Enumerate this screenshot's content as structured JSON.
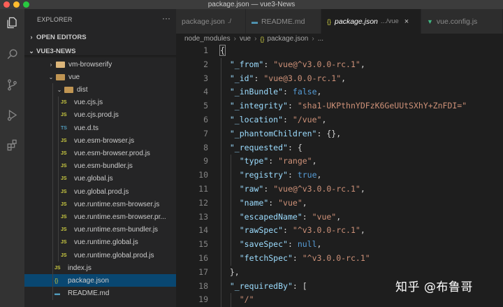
{
  "window": {
    "title": "package.json — vue3-News"
  },
  "activity_bar": {
    "icons": [
      "files-icon",
      "search-icon",
      "source-control-icon",
      "run-debug-icon",
      "extensions-icon"
    ]
  },
  "sidebar": {
    "title": "EXPLORER",
    "open_editors": "OPEN EDITORS",
    "project": "VUE3-NEWS",
    "tree": [
      {
        "label": "vm-browserify",
        "kind": "folder"
      },
      {
        "label": "vue",
        "kind": "folder-open"
      },
      {
        "label": "dist",
        "kind": "folder-open"
      },
      {
        "label": "vue.cjs.js",
        "kind": "js"
      },
      {
        "label": "vue.cjs.prod.js",
        "kind": "js"
      },
      {
        "label": "vue.d.ts",
        "kind": "ts"
      },
      {
        "label": "vue.esm-browser.js",
        "kind": "js"
      },
      {
        "label": "vue.esm-browser.prod.js",
        "kind": "js"
      },
      {
        "label": "vue.esm-bundler.js",
        "kind": "js"
      },
      {
        "label": "vue.global.js",
        "kind": "js"
      },
      {
        "label": "vue.global.prod.js",
        "kind": "js"
      },
      {
        "label": "vue.runtime.esm-browser.js",
        "kind": "js"
      },
      {
        "label": "vue.runtime.esm-browser.pr...",
        "kind": "js"
      },
      {
        "label": "vue.runtime.esm-bundler.js",
        "kind": "js"
      },
      {
        "label": "vue.runtime.global.js",
        "kind": "js"
      },
      {
        "label": "vue.runtime.global.prod.js",
        "kind": "js"
      },
      {
        "label": "index.js",
        "kind": "js"
      },
      {
        "label": "package.json",
        "kind": "json",
        "selected": true
      },
      {
        "label": "README.md",
        "kind": "md"
      }
    ],
    "badges": {
      "js": "JS",
      "ts": "TS",
      "json": "{}",
      "md": "▬"
    }
  },
  "tabs": [
    {
      "label": "package.json",
      "desc": "./",
      "icon": "{}"
    },
    {
      "label": "README.md",
      "desc": "",
      "icon": "▬"
    },
    {
      "label": "package.json",
      "desc": ".../vue",
      "icon": "{}",
      "active": true,
      "close": "×"
    },
    {
      "label": "vue.config.js",
      "desc": "",
      "icon": "▼"
    }
  ],
  "breadcrumb": [
    "node_modules",
    "vue",
    "package.json",
    "..."
  ],
  "editor": {
    "line_numbers": [
      "1",
      "2",
      "3",
      "4",
      "5",
      "6",
      "7",
      "8",
      "9",
      "10",
      "11",
      "12",
      "13",
      "14",
      "15",
      "16",
      "17",
      "18",
      "19"
    ],
    "lines": [
      {
        "indent": 0,
        "pre": "",
        "key": "",
        "mid": "",
        "val": "",
        "post": "{"
      },
      {
        "indent": 1,
        "pre": "",
        "key": "\"_from\"",
        "mid": ": ",
        "val": "\"vue@^v3.0.0-rc.1\"",
        "post": ",",
        "vt": "s"
      },
      {
        "indent": 1,
        "pre": "",
        "key": "\"_id\"",
        "mid": ": ",
        "val": "\"vue@3.0.0-rc.1\"",
        "post": ",",
        "vt": "s"
      },
      {
        "indent": 1,
        "pre": "",
        "key": "\"_inBundle\"",
        "mid": ": ",
        "val": "false",
        "post": ",",
        "vt": "b"
      },
      {
        "indent": 1,
        "pre": "",
        "key": "\"_integrity\"",
        "mid": ": ",
        "val": "\"sha1-UKPthnYDFzK6GeUUtSXhY+ZnFDI=\"",
        "post": "",
        "vt": "s"
      },
      {
        "indent": 1,
        "pre": "",
        "key": "\"_location\"",
        "mid": ": ",
        "val": "\"/vue\"",
        "post": ",",
        "vt": "s"
      },
      {
        "indent": 1,
        "pre": "",
        "key": "\"_phantomChildren\"",
        "mid": ": ",
        "val": "",
        "post": "{},",
        "vt": "p"
      },
      {
        "indent": 1,
        "pre": "",
        "key": "\"_requested\"",
        "mid": ": ",
        "val": "",
        "post": "{",
        "vt": "p"
      },
      {
        "indent": 2,
        "pre": "",
        "key": "\"type\"",
        "mid": ": ",
        "val": "\"range\"",
        "post": ",",
        "vt": "s"
      },
      {
        "indent": 2,
        "pre": "",
        "key": "\"registry\"",
        "mid": ": ",
        "val": "true",
        "post": ",",
        "vt": "b"
      },
      {
        "indent": 2,
        "pre": "",
        "key": "\"raw\"",
        "mid": ": ",
        "val": "\"vue@^v3.0.0-rc.1\"",
        "post": ",",
        "vt": "s"
      },
      {
        "indent": 2,
        "pre": "",
        "key": "\"name\"",
        "mid": ": ",
        "val": "\"vue\"",
        "post": ",",
        "vt": "s"
      },
      {
        "indent": 2,
        "pre": "",
        "key": "\"escapedName\"",
        "mid": ": ",
        "val": "\"vue\"",
        "post": ",",
        "vt": "s"
      },
      {
        "indent": 2,
        "pre": "",
        "key": "\"rawSpec\"",
        "mid": ": ",
        "val": "\"^v3.0.0-rc.1\"",
        "post": ",",
        "vt": "s"
      },
      {
        "indent": 2,
        "pre": "",
        "key": "\"saveSpec\"",
        "mid": ": ",
        "val": "null",
        "post": ",",
        "vt": "b"
      },
      {
        "indent": 2,
        "pre": "",
        "key": "\"fetchSpec\"",
        "mid": ": ",
        "val": "\"^v3.0.0-rc.1\"",
        "post": "",
        "vt": "s"
      },
      {
        "indent": 1,
        "pre": "",
        "key": "",
        "mid": "",
        "val": "",
        "post": "},",
        "vt": "p"
      },
      {
        "indent": 1,
        "pre": "",
        "key": "\"_requiredBy\"",
        "mid": ": ",
        "val": "",
        "post": "[",
        "vt": "p"
      },
      {
        "indent": 2,
        "pre": "",
        "key": "",
        "mid": "",
        "val": "\"/\"",
        "post": "",
        "vt": "s"
      }
    ]
  },
  "watermark": "知乎 @布鲁哥",
  "colors": {
    "accent": "#094771",
    "key": "#9cdcfe",
    "string": "#ce9178",
    "keyword": "#569cd6"
  }
}
